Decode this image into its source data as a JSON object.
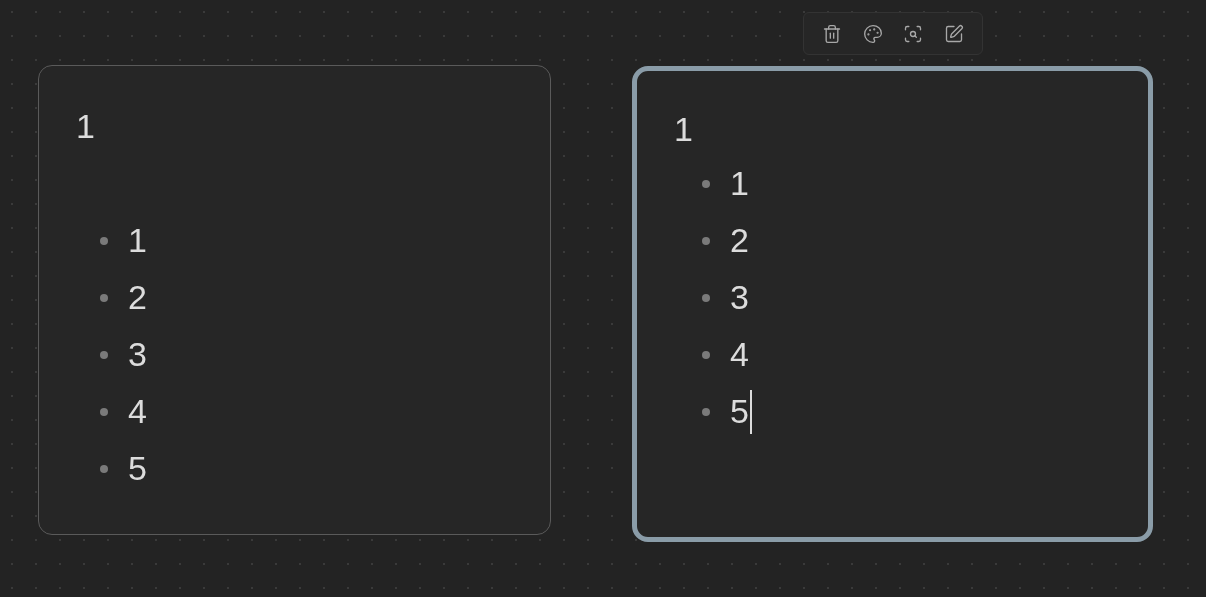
{
  "cards": [
    {
      "selected": false,
      "editing": false,
      "blank_line_after_title": true,
      "title": "1",
      "items": [
        "1",
        "2",
        "3",
        "4",
        "5"
      ]
    },
    {
      "selected": true,
      "editing": true,
      "blank_line_after_title": false,
      "title": "1",
      "items": [
        "1",
        "2",
        "3",
        "4",
        "5"
      ]
    }
  ]
}
